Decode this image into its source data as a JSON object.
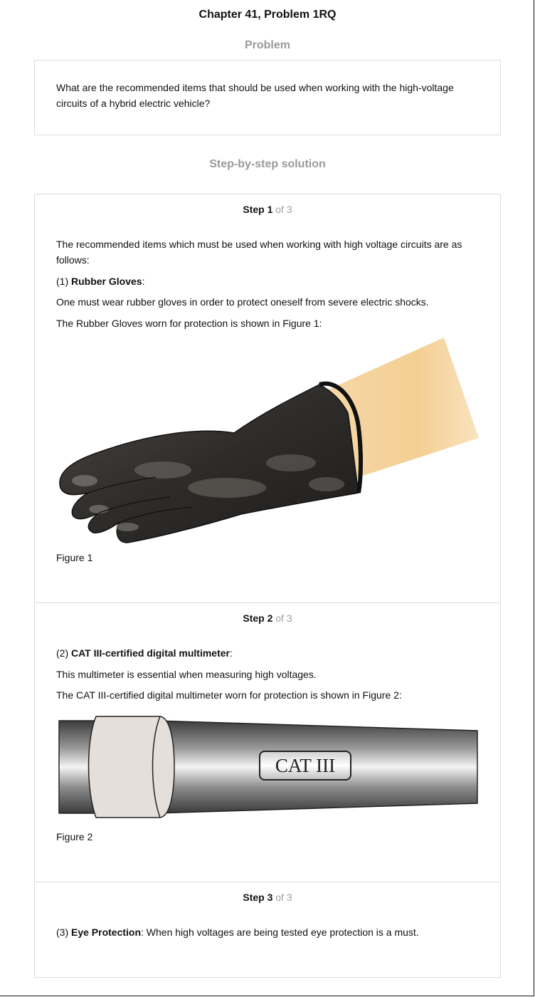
{
  "header": {
    "title": "Chapter 41, Problem 1RQ"
  },
  "problem": {
    "heading": "Problem",
    "text": "What are the recommended items that should be used when working with the high-voltage circuits of a hybrid electric vehicle?"
  },
  "solution": {
    "heading": "Step-by-step solution",
    "steps": [
      {
        "label": "Step 1",
        "of": "of 3",
        "intro": "The recommended items which must be used when working with high voltage circuits are as follows:",
        "item_prefix": "(1) ",
        "item_name": "Rubber Gloves",
        "item_suffix": ":",
        "line1": "One must wear rubber gloves in order to protect oneself from severe electric shocks.",
        "line2": "The Rubber Gloves worn for protection is shown in Figure 1:",
        "figure_caption": "Figure 1"
      },
      {
        "label": "Step 2",
        "of": "of 3",
        "item_prefix": "(2) ",
        "item_name": "CAT III-certified digital multimeter",
        "item_suffix": ":",
        "line1": "This multimeter is essential when measuring high voltages.",
        "line2": "The CAT III-certified digital multimeter worn for protection is shown in Figure 2:",
        "figure_label": "CAT III",
        "figure_caption": "Figure 2"
      },
      {
        "label": "Step 3",
        "of": "of 3",
        "item_prefix": "(3) ",
        "item_name": "Eye Protection",
        "item_suffix": ": When high voltages are being tested eye protection is a must."
      }
    ]
  }
}
